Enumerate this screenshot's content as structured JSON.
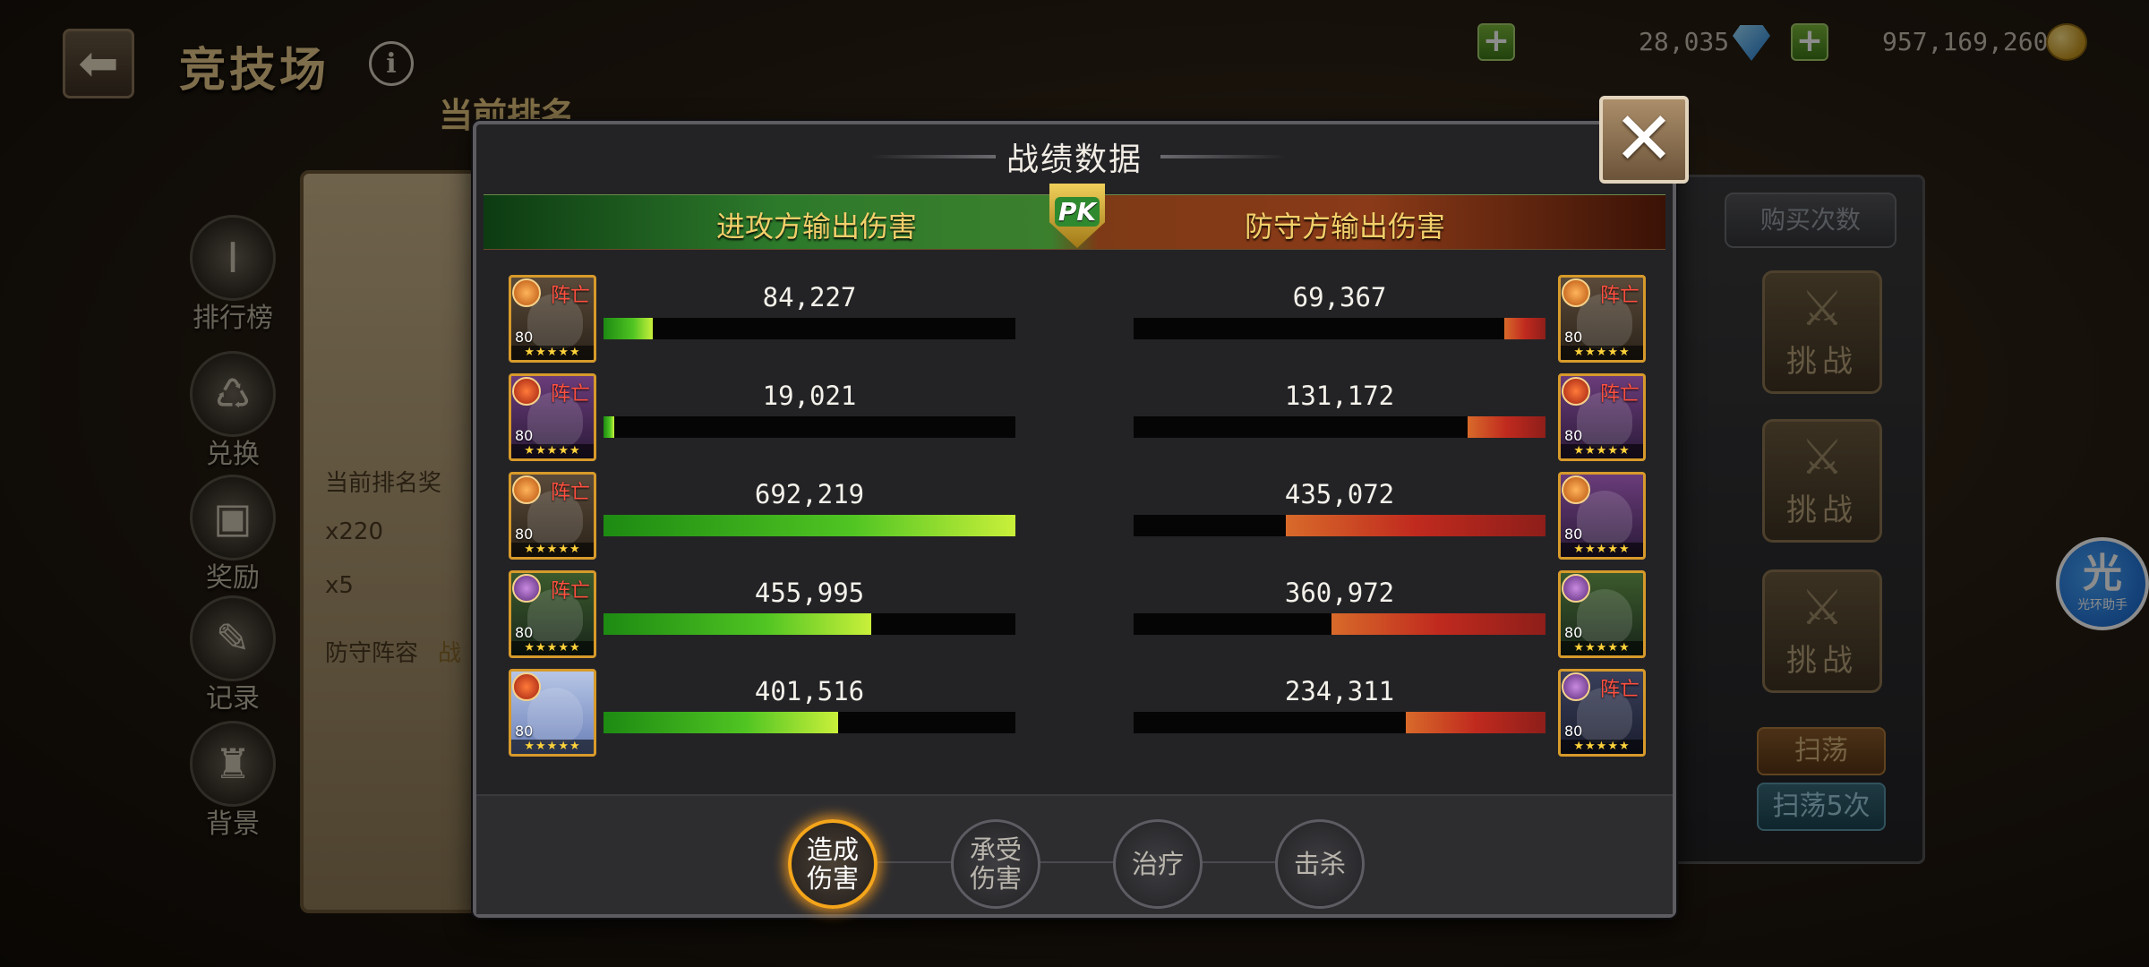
{
  "page": {
    "title": "竞技场",
    "rank_title": "当前排名",
    "back_icon": "back-arrow-icon"
  },
  "resources": {
    "gems": "28,035",
    "gold": "957,169,260"
  },
  "side_nav": [
    {
      "label": "排行榜",
      "icon": "trophy-icon"
    },
    {
      "label": "兑换",
      "icon": "exchange-icon"
    },
    {
      "label": "奖励",
      "icon": "chest-icon"
    },
    {
      "label": "记录",
      "icon": "book-icon"
    },
    {
      "label": "背景",
      "icon": "castle-icon"
    }
  ],
  "left_panel": {
    "rank_reward_label": "当前排名奖",
    "gem_count": "x220",
    "item_count": "x5",
    "defense_label": "防守阵容",
    "battle_label": "战"
  },
  "right_panel": {
    "buy_label": "购买次数",
    "challenge_label": "挑战",
    "sweep_label": "扫荡",
    "sweep5_label": "扫荡5次"
  },
  "helper": {
    "big": "光",
    "small": "光环助手"
  },
  "modal": {
    "title": "战绩数据",
    "attacker_header": "进攻方输出伤害",
    "defender_header": "防守方输出伤害",
    "pk_label": "PK",
    "dead_label": "阵亡",
    "level": "80",
    "stars": "★★★★★",
    "close_icon": "close-x-icon",
    "tabs": [
      {
        "line1": "造成",
        "line2": "伤害",
        "active": true
      },
      {
        "line1": "承受",
        "line2": "伤害",
        "active": false
      },
      {
        "line1": "治疗",
        "line2": "",
        "active": false
      },
      {
        "line1": "击杀",
        "line2": "",
        "active": false
      }
    ],
    "attackers": [
      {
        "damage": "84,227",
        "fill": 0.12,
        "dead": true
      },
      {
        "damage": "19,021",
        "fill": 0.027,
        "dead": true
      },
      {
        "damage": "692,219",
        "fill": 1.0,
        "dead": true
      },
      {
        "damage": "455,995",
        "fill": 0.65,
        "dead": true
      },
      {
        "damage": "401,516",
        "fill": 0.57,
        "dead": false
      }
    ],
    "defenders": [
      {
        "damage": "69,367",
        "fill": 0.1,
        "dead": true
      },
      {
        "damage": "131,172",
        "fill": 0.19,
        "dead": true
      },
      {
        "damage": "435,072",
        "fill": 0.63,
        "dead": false
      },
      {
        "damage": "360,972",
        "fill": 0.52,
        "dead": false
      },
      {
        "damage": "234,311",
        "fill": 0.34,
        "dead": true
      }
    ]
  },
  "colors": {
    "attack_bar": "#4fc422",
    "defend_bar": "#c02a1e",
    "header_text": "#f2cf6a",
    "active_tab_glow": "#f4a51a"
  }
}
